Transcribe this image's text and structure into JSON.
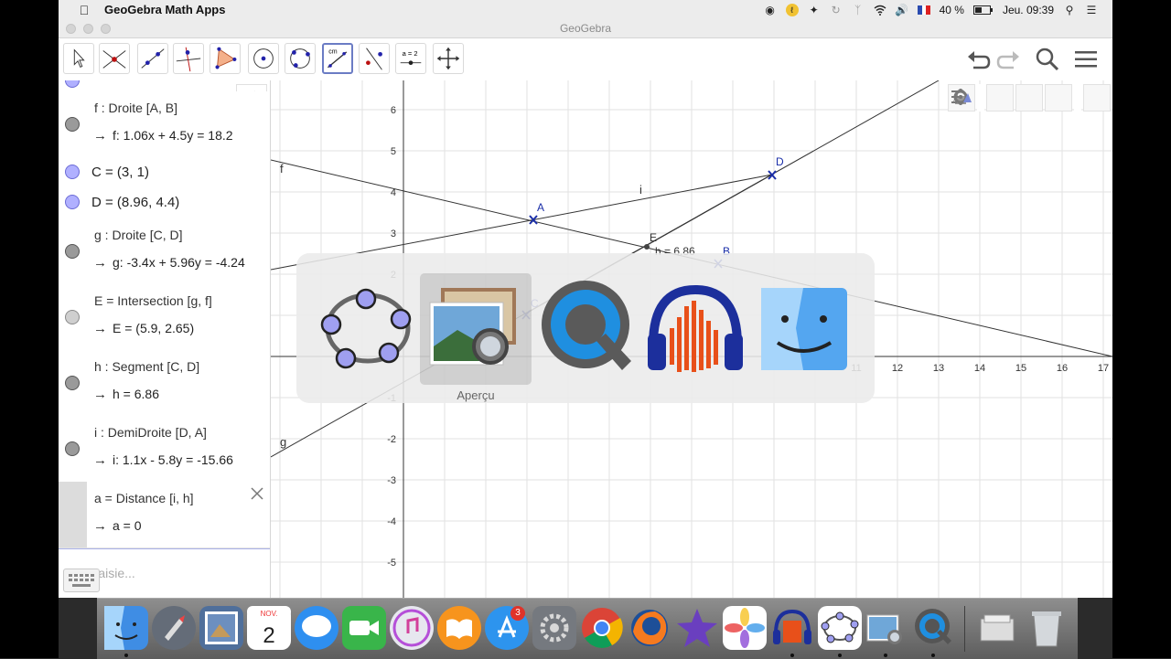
{
  "menubar": {
    "app_name": "GeoGebra Math Apps",
    "battery": "40 %",
    "clock": "Jeu. 09:39"
  },
  "window": {
    "title": "GeoGebra"
  },
  "toolbar": {
    "tools": [
      "move-tool",
      "intersect-tool",
      "line-tool",
      "perpendicular-tool",
      "polygon-tool",
      "circle-center-tool",
      "circle-three-points-tool",
      "distance-tool",
      "reflect-tool",
      "slider-tool",
      "move-graphics-tool"
    ],
    "slider_tool_label": "a = 2",
    "distance_tool_label": "cm"
  },
  "algebra": {
    "rows": [
      {
        "def": "f : Droite [A, B]",
        "value": "f: 1.06x + 4.5y = 18.2",
        "marble": "gray"
      },
      {
        "single": "C = (3, 1)",
        "marble": "blue"
      },
      {
        "single": "D = (8.96, 4.4)",
        "marble": "blue"
      },
      {
        "def": "g : Droite [C, D]",
        "value": "g: -3.4x + 5.96y = -4.24",
        "marble": "gray"
      },
      {
        "def": "E = Intersection [g, f]",
        "value": "E = (5.9, 2.65)",
        "marble": "empty"
      },
      {
        "def": "h : Segment [C, D]",
        "value": "h = 6.86",
        "marble": "gray"
      },
      {
        "def": "i : DemiDroite [D, A]",
        "value": "i: 1.1x - 5.8y = -15.66",
        "marble": "gray"
      },
      {
        "def": "a = Distance [i, h]",
        "value": "a = 0",
        "marble": "none"
      }
    ],
    "input_placeholder": "Saisie..."
  },
  "graphics": {
    "x_ticks": [
      "11",
      "12",
      "13",
      "14",
      "15",
      "16",
      "17"
    ],
    "y_ticks": [
      "6",
      "5",
      "4",
      "3",
      "2",
      "-1",
      "-2",
      "-3",
      "-4",
      "-5"
    ],
    "labels": {
      "A": "A",
      "B": "B",
      "C": "C",
      "D": "D",
      "E": "E",
      "f": "f",
      "g": "g",
      "i": "i",
      "h": "h = 6.86"
    }
  },
  "switcher": {
    "apps": [
      "geogebra-icon",
      "apercu-icon",
      "quicktime-icon",
      "audacity-icon",
      "finder-icon"
    ],
    "selected_label": "Aperçu"
  },
  "dock": {
    "items": [
      "finder",
      "launchpad",
      "preview-photo",
      "calendar",
      "messages",
      "facetime",
      "itunes",
      "ibooks",
      "app-store",
      "system-preferences",
      "chrome",
      "firefox",
      "imovie",
      "photos",
      "audacity",
      "geogebra",
      "apercu",
      "quicktime"
    ],
    "calendar_month": "NOV.",
    "calendar_day": "2",
    "app_store_badge": "3"
  }
}
